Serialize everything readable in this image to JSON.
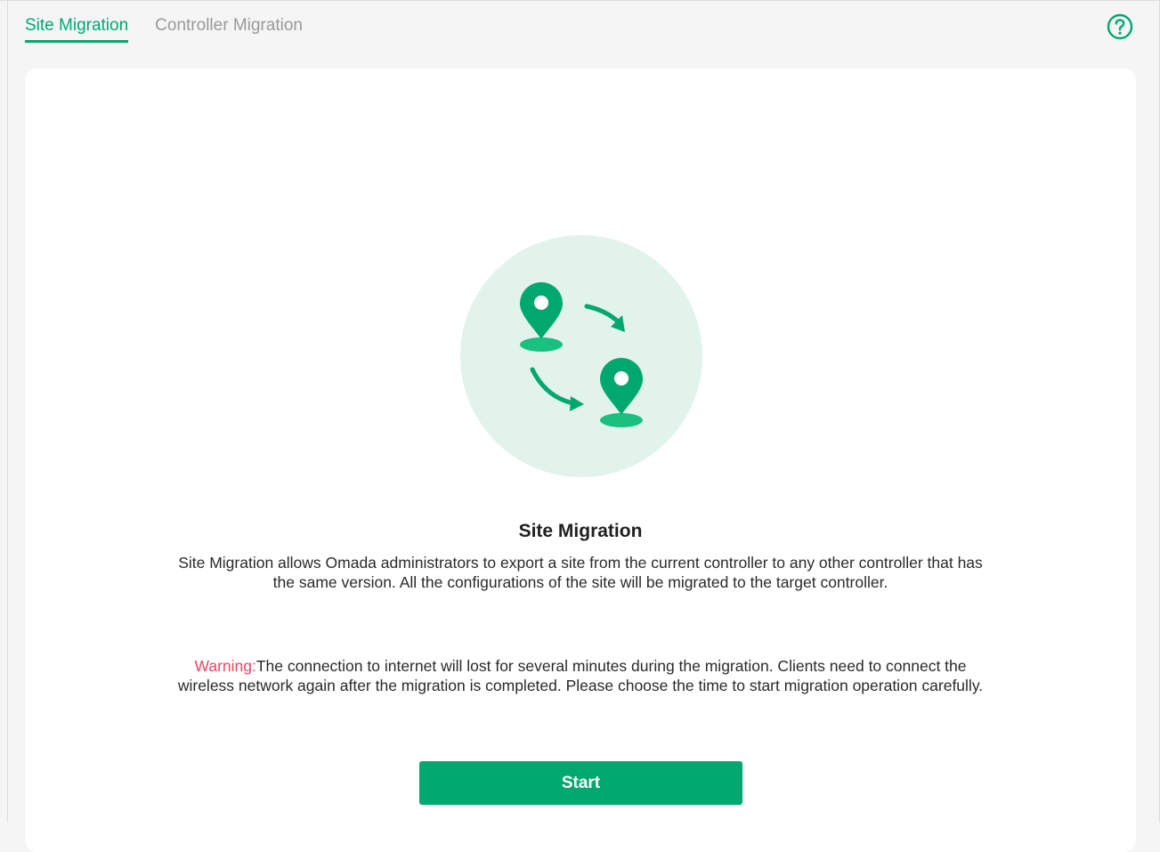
{
  "tabs": [
    {
      "label": "Site Migration",
      "active": true
    },
    {
      "label": "Controller Migration",
      "active": false
    }
  ],
  "help": {
    "icon": "help-circle-icon"
  },
  "illustration": {
    "icon": "site-migration-illustration"
  },
  "section": {
    "title": "Site Migration",
    "description": "Site Migration allows Omada administrators to export a site from the current controller to any other controller that has the same version. All the configurations of the site will be migrated to the target controller.",
    "warning_label": "Warning:",
    "warning_text": "The connection to internet will lost for several minutes during the migration. Clients need to connect the wireless network again after the migration is completed. Please choose the time to start migration operation carefully.",
    "start_label": "Start"
  },
  "colors": {
    "accent": "#00a870",
    "warning": "#ee4466",
    "illustration_bg": "#e2f3ec"
  }
}
